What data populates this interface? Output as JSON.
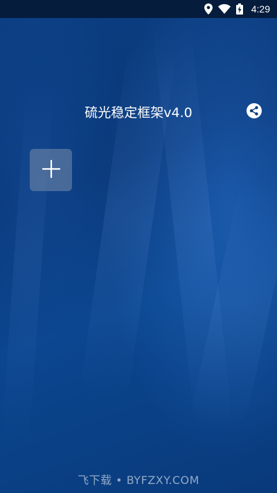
{
  "status_bar": {
    "time": "4:29",
    "icons": [
      "location-icon",
      "wifi-icon",
      "battery-charging-icon"
    ]
  },
  "app": {
    "title": "硫光稳定框架v4.0"
  },
  "actions": {
    "share_icon": "share-icon",
    "add_icon": "plus-icon"
  },
  "watermark": {
    "text": "飞下载 • BYFZXY.COM"
  },
  "colors": {
    "background": "#0a3a78",
    "status_bar": "#061c3c",
    "add_button": "#788caa"
  }
}
